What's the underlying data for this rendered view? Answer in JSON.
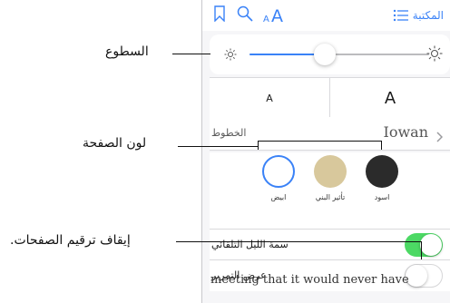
{
  "toolbar": {
    "library_label": "المكتبة",
    "icons": [
      "bookmark-icon",
      "search-icon",
      "text-size-icon",
      "list-icon"
    ],
    "text_size_glyph": "AA"
  },
  "brightness": {
    "level_percent": 42
  },
  "font_size": {
    "small_label": "A",
    "large_label": "A"
  },
  "fonts": {
    "label": "الخطوط",
    "value": "Iowan"
  },
  "page_colors": [
    {
      "label": "ابيض",
      "color": "#ffffff",
      "selected": true
    },
    {
      "label": "تأثير البني",
      "color": "#d8c89c",
      "selected": false
    },
    {
      "label": "اسود",
      "color": "#2b2b2b",
      "selected": false
    }
  ],
  "night_theme": {
    "label": "سمة الليل التلقائي",
    "enabled": true
  },
  "scroll_view": {
    "label": "عرض التمرير",
    "enabled": false
  },
  "book_text": {
    "line1": "meeting that it would never have"
  },
  "callouts": {
    "brightness": "السطوع",
    "page_color": "لون الصفحة",
    "pagination": "إيقاف ترقيم الصفحات."
  },
  "colors": {
    "accent": "#3a82f7",
    "toggle_on": "#4cd964"
  }
}
